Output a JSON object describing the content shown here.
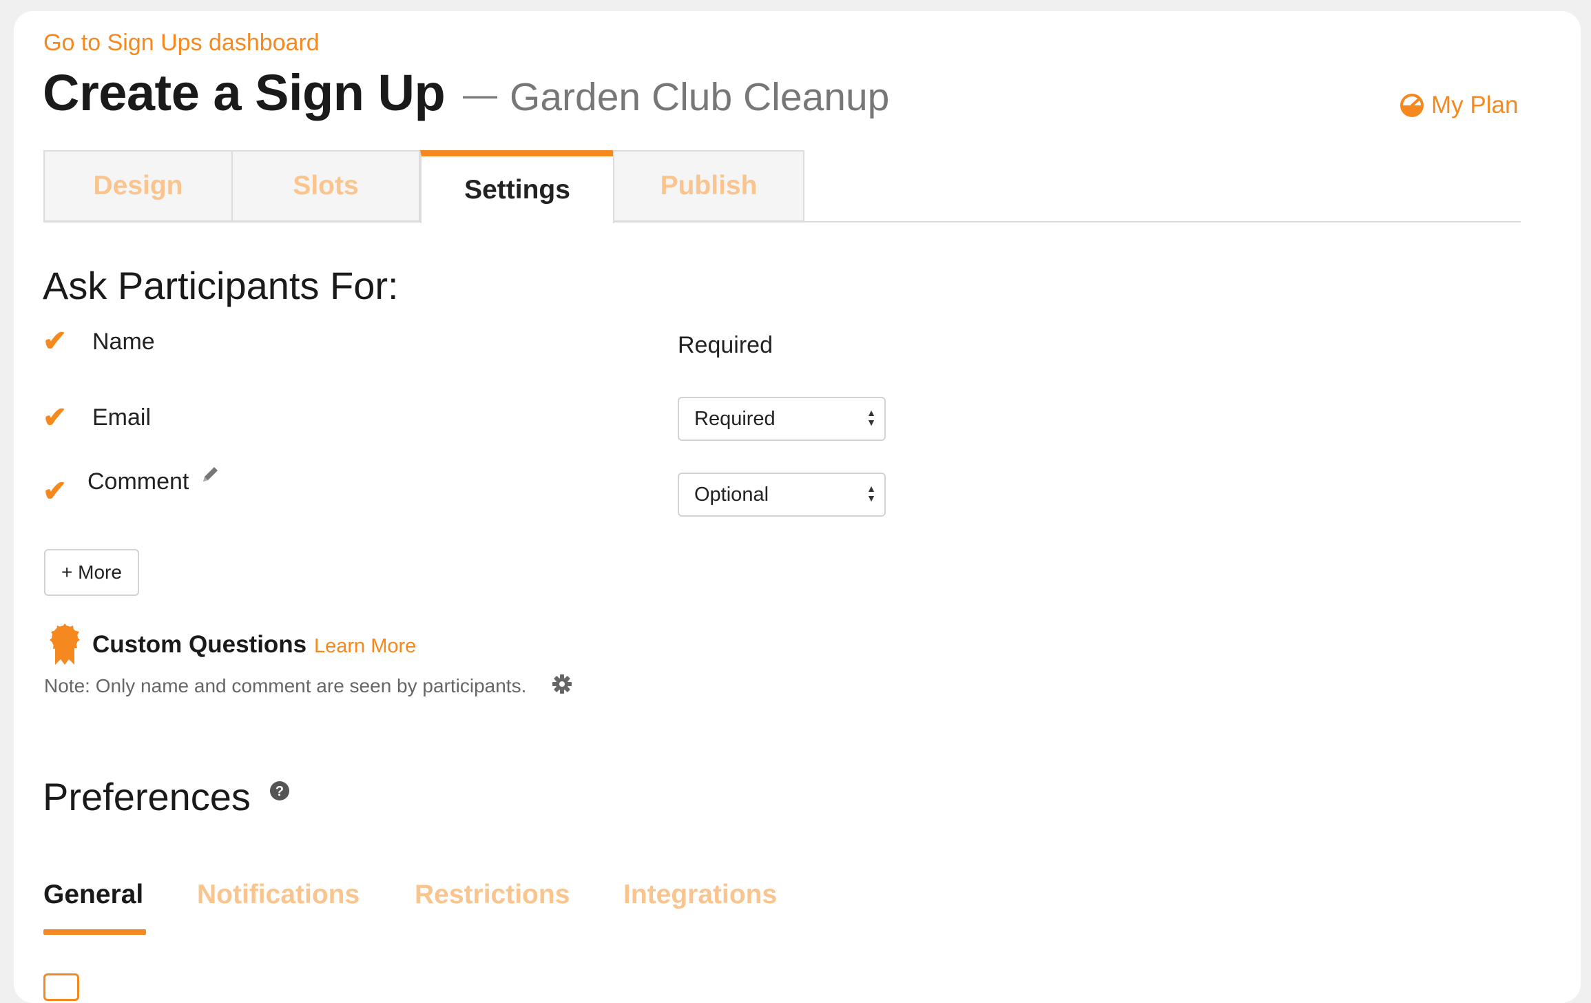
{
  "header": {
    "back_link": "Go to Sign Ups dashboard",
    "title": "Create a Sign Up",
    "dash": "—",
    "event_name": "Garden Club Cleanup",
    "my_plan": "My Plan"
  },
  "tabs": [
    {
      "label": "Design",
      "active": false
    },
    {
      "label": "Slots",
      "active": false
    },
    {
      "label": "Settings",
      "active": true
    },
    {
      "label": "Publish",
      "active": false
    }
  ],
  "ask": {
    "title": "Ask Participants For:",
    "fields": [
      {
        "label": "Name",
        "checked": true,
        "requirement": "Required"
      },
      {
        "label": "Email",
        "checked": true,
        "select_value": "Required"
      },
      {
        "label": "Comment",
        "checked": true,
        "select_value": "Optional"
      }
    ],
    "more_button": "+ More"
  },
  "custom_questions": {
    "title": "Custom Questions",
    "learn_more": "Learn More",
    "note": "Note: Only name and comment are seen by participants."
  },
  "preferences": {
    "title": "Preferences",
    "subtabs": [
      {
        "label": "General",
        "active": true
      },
      {
        "label": "Notifications",
        "active": false
      },
      {
        "label": "Restrictions",
        "active": false
      },
      {
        "label": "Integrations",
        "active": false
      }
    ]
  },
  "colors": {
    "accent": "#f5891f",
    "accent_light": "#f9c48e",
    "text": "#1a1a1a",
    "muted": "#666666"
  },
  "icons": {
    "check": "checkmark-icon",
    "pencil": "pencil-icon",
    "badge": "award-ribbon-icon",
    "gear": "gear-icon",
    "help": "question-circle-icon",
    "plan": "gauge-icon"
  }
}
